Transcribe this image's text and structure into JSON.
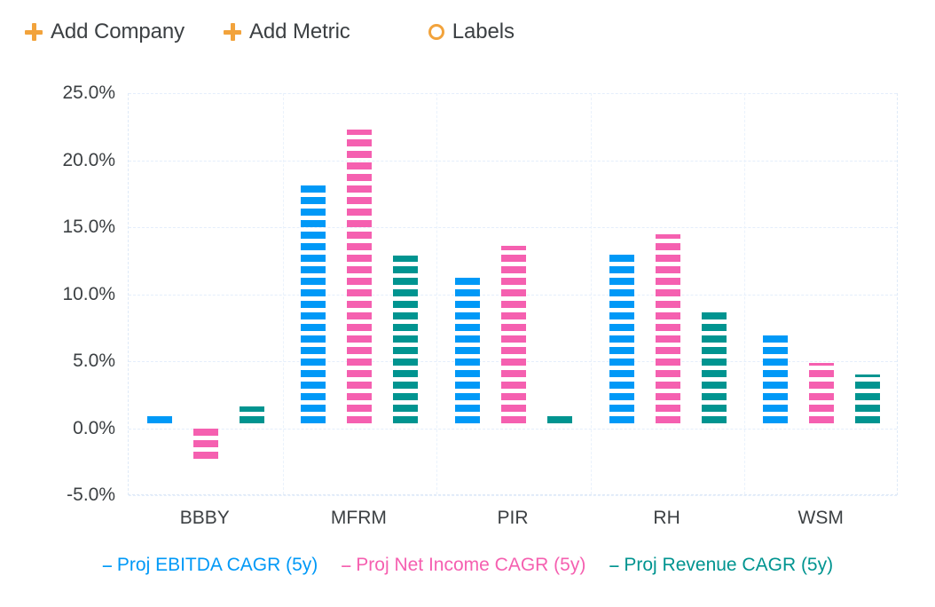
{
  "toolbar": {
    "buttons": [
      {
        "label": "Add Company",
        "icon": "plus-icon"
      },
      {
        "label": "Add Metric",
        "icon": "plus-icon"
      },
      {
        "label": "Labels",
        "icon": "circle-outline-icon"
      }
    ],
    "accent_color": "#F2A33C"
  },
  "chart_data": {
    "type": "bar",
    "title": "",
    "xlabel": "",
    "ylabel": "",
    "categories": [
      "BBBY",
      "MFRM",
      "PIR",
      "RH",
      "WSM"
    ],
    "series": [
      {
        "name": "Proj EBITDA CAGR (5y)",
        "color": "#0099F7",
        "values": [
          1.2,
          18.2,
          11.5,
          13.2,
          6.9
        ]
      },
      {
        "name": "Proj Net Income CAGR (5y)",
        "color": "#F560B0",
        "values": [
          -2.4,
          22.3,
          13.6,
          14.5,
          4.9
        ]
      },
      {
        "name": "Proj Revenue CAGR (5y)",
        "color": "#009490",
        "values": [
          1.6,
          12.9,
          1.2,
          8.7,
          4.0
        ]
      }
    ],
    "ylim": [
      -5.0,
      25.0
    ],
    "yticks": [
      25.0,
      20.0,
      15.0,
      10.0,
      5.0,
      0.0,
      -5.0
    ],
    "ytick_labels": [
      "25.0%",
      "20.0%",
      "15.0%",
      "10.0%",
      "5.0%",
      "0.0%",
      "-5.0%"
    ],
    "grid": true,
    "legend_position": "bottom",
    "bar_style": "striped",
    "legend_marker": "--"
  }
}
